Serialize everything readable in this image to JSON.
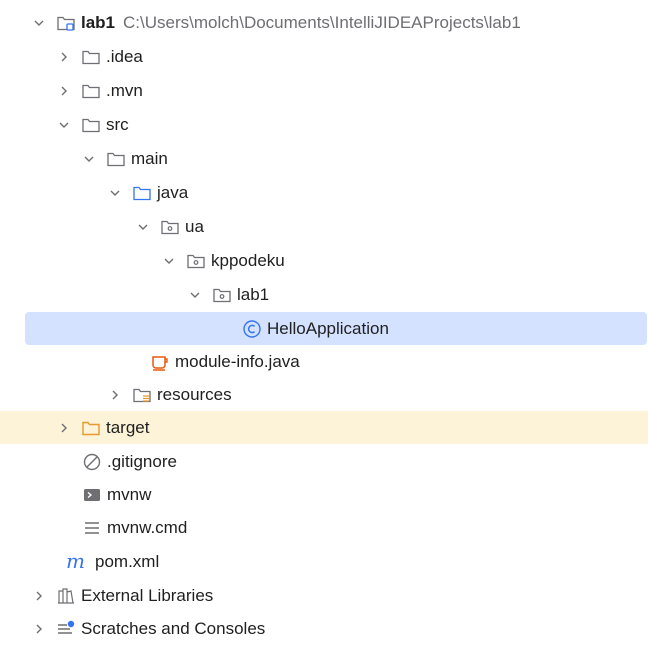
{
  "project": {
    "name": "lab1",
    "path": "C:\\Users\\molch\\Documents\\IntelliJIDEAProjects\\lab1"
  },
  "items": {
    "idea": ".idea",
    "mvn": ".mvn",
    "src": "src",
    "main": "main",
    "java": "java",
    "ua": "ua",
    "kppodeku": "kppodeku",
    "lab1pkg": "lab1",
    "hello": "HelloApplication",
    "moduleinfo": "module-info.java",
    "resources": "resources",
    "target": "target",
    "gitignore": ".gitignore",
    "mvnw": "mvnw",
    "mvnwcmd": "mvnw.cmd",
    "pom": "pom.xml",
    "extlibs": "External Libraries",
    "scratches": "Scratches and Consoles"
  },
  "colors": {
    "selected_bg": "#d4e2ff",
    "excluded_bg": "#fdf3d8",
    "folder_gray": "#6e6e73",
    "source_blue": "#3574f0",
    "target_orange": "#e89a2c",
    "maven_blue": "#3574f0"
  }
}
